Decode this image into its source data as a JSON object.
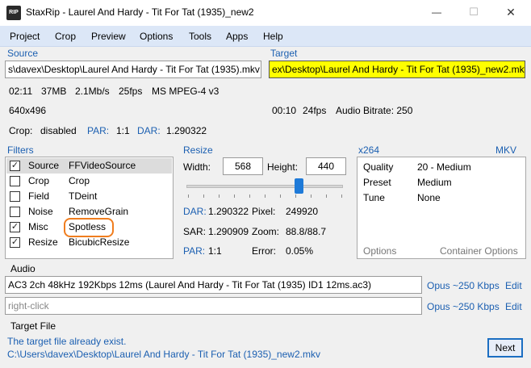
{
  "app": {
    "icon_text": "RIP",
    "title": "StaxRip - Laurel And Hardy - Tit For Tat (1935)_new2"
  },
  "window_controls": {
    "minimize": "—",
    "maximize": "☐",
    "close": "✕"
  },
  "menu": [
    "Project",
    "Crop",
    "Preview",
    "Options",
    "Tools",
    "Apps",
    "Help"
  ],
  "source": {
    "label": "Source",
    "path": "s\\davex\\Desktop\\Laurel And Hardy - Tit For Tat (1935).mkv",
    "duration": "02:11",
    "size": "37MB",
    "bitrate": "2.1Mb/s",
    "fps": "25fps",
    "codec": "MS MPEG-4 v3",
    "resolution": "640x496",
    "crop_label": "Crop:",
    "crop_value": "disabled",
    "par_label": "PAR:",
    "par_value": "1:1",
    "dar_label": "DAR:",
    "dar_value": "1.290322"
  },
  "target": {
    "label": "Target",
    "path": "ex\\Desktop\\Laurel And Hardy - Tit For Tat (1935)_new2.mkv",
    "duration": "00:10",
    "fps": "24fps",
    "audio_bitrate": "Audio Bitrate: 250"
  },
  "filters": {
    "label": "Filters",
    "rows": [
      {
        "checked": true,
        "category": "Source",
        "value": "FFVideoSource"
      },
      {
        "checked": false,
        "category": "Crop",
        "value": "Crop"
      },
      {
        "checked": false,
        "category": "Field",
        "value": "TDeint"
      },
      {
        "checked": false,
        "category": "Noise",
        "value": "RemoveGrain"
      },
      {
        "checked": true,
        "category": "Misc",
        "value": "Spotless"
      },
      {
        "checked": true,
        "category": "Resize",
        "value": "BicubicResize"
      }
    ],
    "check_mark": "✓"
  },
  "resize": {
    "label": "Resize",
    "width_label": "Width:",
    "width_value": "568",
    "height_label": "Height:",
    "height_value": "440",
    "slider_fraction": 0.72,
    "dar_label": "DAR:",
    "dar_value": "1.290322",
    "pixel_label": "Pixel:",
    "pixel_value": "249920",
    "sar_label": "SAR:",
    "sar_value": "1.290909",
    "zoom_label": "Zoom:",
    "zoom_value": "88.8/88.7",
    "par_label": "PAR:",
    "par_value": "1:1",
    "error_label": "Error:",
    "error_value": "0.05%"
  },
  "encoder": {
    "label": "x264",
    "container": "MKV",
    "rows": [
      {
        "key": "Quality",
        "value": "20 - Medium"
      },
      {
        "key": "Preset",
        "value": "Medium"
      },
      {
        "key": "Tune",
        "value": "None"
      }
    ],
    "options_link": "Options",
    "container_options_link": "Container Options"
  },
  "audio": {
    "label": "Audio",
    "track1": "AC3 2ch 48kHz 192Kbps 12ms (Laurel And Hardy - Tit For Tat (1935) ID1 12ms.ac3)",
    "track1_codec": "Opus ~250 Kbps",
    "track1_edit": "Edit",
    "track2_placeholder": "right-click",
    "track2_codec": "Opus ~250 Kbps",
    "track2_edit": "Edit"
  },
  "target_file": {
    "label": "Target File",
    "message": "The target file already exist.",
    "path": "C:\\Users\\davex\\Desktop\\Laurel And Hardy - Tit For Tat (1935)_new2.mkv"
  },
  "next_button": "Next",
  "colors": {
    "accent": "#1b5fb1",
    "menubar": "#dce7f7",
    "target_highlight": "#ffff00",
    "annotation_ring": "#f07d1e",
    "slider_thumb": "#1e7ad8"
  }
}
